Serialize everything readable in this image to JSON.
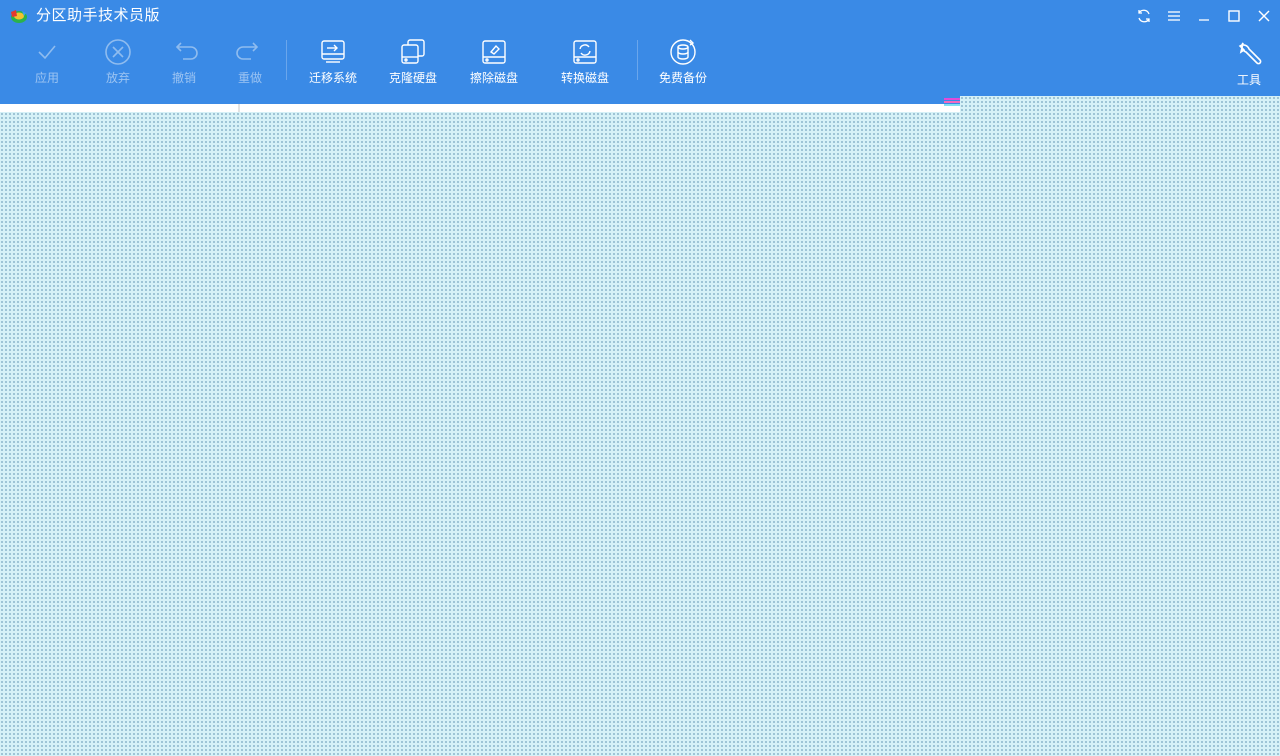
{
  "window": {
    "title": "分区助手技术员版"
  },
  "toolbar": {
    "apply": "应用",
    "discard": "放弃",
    "undo": "撤销",
    "redo": "重做",
    "migrate_os": "迁移系统",
    "clone_disk": "克隆硬盘",
    "wipe_disk": "擦除磁盘",
    "convert_disk": "转换磁盘",
    "free_backup": "免费备份",
    "tools": "工具"
  },
  "colors": {
    "header": "#3a8ae6",
    "content_background": "#d6f1f7",
    "disabled_text": "#9cc4f2"
  }
}
